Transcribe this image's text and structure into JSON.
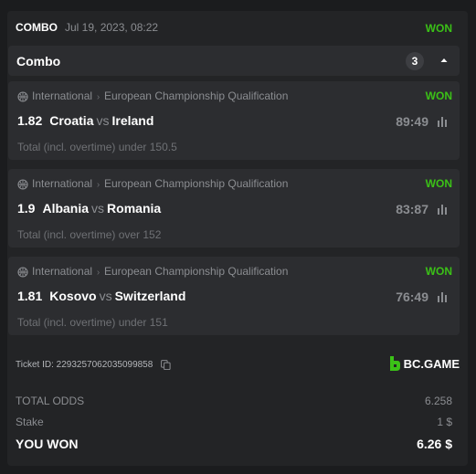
{
  "header": {
    "type": "COMBO",
    "date": "Jul 19, 2023, 08:22",
    "status": "WON"
  },
  "combo": {
    "label": "Combo",
    "count": "3"
  },
  "bets": [
    {
      "category": "International",
      "tournament": "European Championship Qualification",
      "status": "WON",
      "odds": "1.82",
      "home": "Croatia",
      "vs": "vs",
      "away": "Ireland",
      "score": "89:49",
      "market": "Total (incl. overtime) under 150.5"
    },
    {
      "category": "International",
      "tournament": "European Championship Qualification",
      "status": "WON",
      "odds": "1.9",
      "home": "Albania",
      "vs": "vs",
      "away": "Romania",
      "score": "83:87",
      "market": "Total (incl. overtime) over 152"
    },
    {
      "category": "International",
      "tournament": "European Championship Qualification",
      "status": "WON",
      "odds": "1.81",
      "home": "Kosovo",
      "vs": "vs",
      "away": "Switzerland",
      "score": "76:49",
      "market": "Total (incl. overtime) under 151"
    }
  ],
  "ticket": {
    "label": "Ticket ID:",
    "id": "2293257062035099858"
  },
  "brand": {
    "name": "BC.GAME"
  },
  "summary": {
    "total_odds_label": "TOTAL ODDS",
    "total_odds": "6.258",
    "stake_label": "Stake",
    "stake": "1 $",
    "won_label": "YOU WON",
    "won": "6.26 $"
  },
  "colors": {
    "won": "#3bc117",
    "card": "#232426",
    "row": "#2c2d30",
    "background": "#1b1c1e"
  },
  "icons": [
    "basketball-icon",
    "stats-icon",
    "copy-icon",
    "chevron-up-icon",
    "bc-game-logo"
  ]
}
